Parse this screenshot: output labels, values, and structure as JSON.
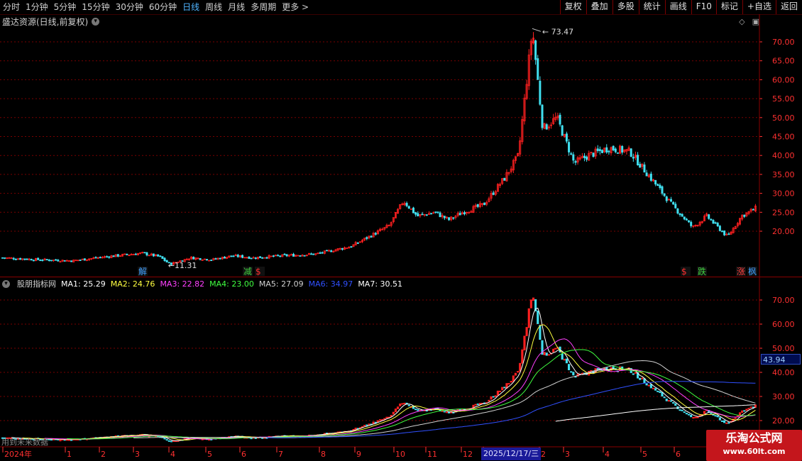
{
  "toolbar": {
    "periods": [
      {
        "label": "分时",
        "active": false
      },
      {
        "label": "1分钟",
        "active": false
      },
      {
        "label": "5分钟",
        "active": false
      },
      {
        "label": "15分钟",
        "active": false
      },
      {
        "label": "30分钟",
        "active": false
      },
      {
        "label": "60分钟",
        "active": false
      },
      {
        "label": "日线",
        "active": true
      },
      {
        "label": "周线",
        "active": false
      },
      {
        "label": "月线",
        "active": false
      },
      {
        "label": "多周期",
        "active": false
      },
      {
        "label": "更多 >",
        "active": false
      }
    ],
    "actions": [
      "复权",
      "叠加",
      "多股",
      "统计",
      "画线",
      "F10",
      "标记",
      "+自选",
      "返回"
    ]
  },
  "chart_title": "盛达资源(日线,前复权)",
  "main_chart": {
    "max_label": "73.47",
    "min_label": "11.31",
    "y_ticks": [
      "70.00",
      "65.00",
      "60.00",
      "55.00",
      "50.00",
      "45.00",
      "40.00",
      "35.00",
      "30.00",
      "25.00",
      "20.00"
    ],
    "markers": [
      {
        "text": "解",
        "color": "#3fa0ff"
      },
      {
        "text": "减",
        "color": "#40d040"
      },
      {
        "text": "$",
        "color": "#ff3030"
      },
      {
        "text": "$",
        "color": "#ff3030"
      },
      {
        "text": "跌",
        "color": "#40d040"
      },
      {
        "text": "涨",
        "color": "#ff4040"
      },
      {
        "text": "枫",
        "color": "#3fa0ff"
      }
    ]
  },
  "indicator": {
    "name": "股朋指标网",
    "mas": [
      {
        "label": "MA1: 25.29",
        "color": "#ffffff"
      },
      {
        "label": "MA2: 24.76",
        "color": "#ffff40"
      },
      {
        "label": "MA3: 22.82",
        "color": "#ff40ff"
      },
      {
        "label": "MA4: 23.00",
        "color": "#40ff40"
      },
      {
        "label": "MA5: 27.09",
        "color": "#d0d0d0"
      },
      {
        "label": "MA6: 34.97",
        "color": "#3050ff"
      },
      {
        "label": "MA7: 30.51",
        "color": "#ffffff"
      }
    ],
    "y_ticks": [
      "70.00",
      "60.00",
      "50.00",
      "40.00",
      "30.00",
      "20.00"
    ],
    "highlight_value": "43.94"
  },
  "x_axis": {
    "labels": [
      "2024年",
      "1",
      "2",
      "3",
      "4",
      "5",
      "6",
      "7",
      "8",
      "9",
      "10",
      "11",
      "12",
      "2025/12/17/三",
      "2",
      "3",
      "4",
      "5",
      "6"
    ]
  },
  "overlay_text": "用到未来数据",
  "watermark": {
    "line1": "乐淘公式网",
    "line2": "www.60lt.com"
  },
  "colors": {
    "up": "#ff2020",
    "down": "#40e0f0",
    "grid": "#7a0000",
    "axis": "#ff3030"
  }
}
